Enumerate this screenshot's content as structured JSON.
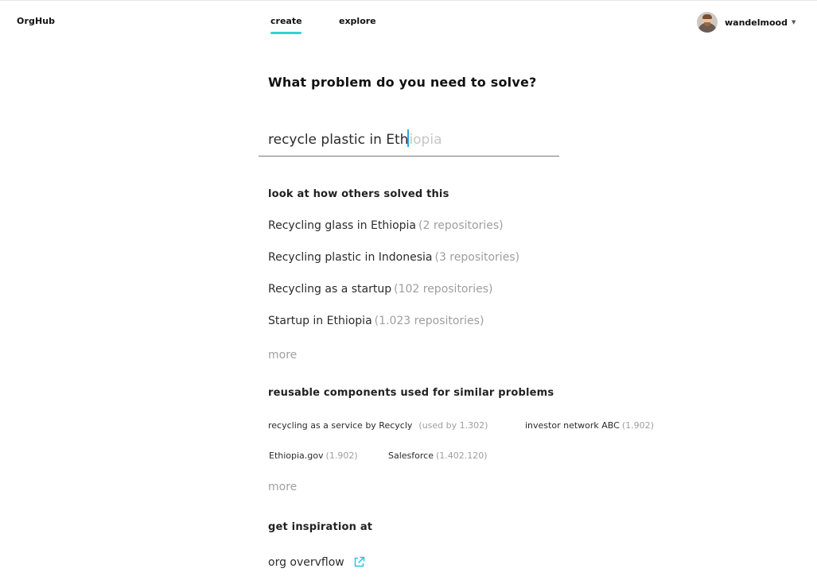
{
  "brand": {
    "name": "OrgHub"
  },
  "nav": {
    "tabs": [
      {
        "label": "create",
        "active": true
      },
      {
        "label": "explore",
        "active": false
      }
    ],
    "accent_color": "#2dd4d4"
  },
  "user": {
    "name": "wandelmood",
    "caret_icon": "chevron-down-icon"
  },
  "main": {
    "question": "What problem do you need to solve?",
    "search": {
      "typed": "recycle plastic in Eth",
      "suggestion": "iopia",
      "cursor_color": "#2aa7e8"
    },
    "solutions_section": {
      "title": "look at how others solved this",
      "items": [
        {
          "label": "Recycling glass in Ethiopia",
          "count": "(2 repositories)"
        },
        {
          "label": "Recycling plastic in Indonesia",
          "count": "(3 repositories)"
        },
        {
          "label": "Recycling as a startup",
          "count": "(102 repositories)"
        },
        {
          "label": "Startup in Ethiopia",
          "count": "(1.023 repositories)"
        }
      ],
      "more": "more"
    },
    "components_section": {
      "title": "reusable components used for similar problems",
      "items": [
        {
          "label": "recycling as a service by Recycly",
          "count": "(used  by 1.302)"
        },
        {
          "label": "investor network ABC",
          "count": "(1.902)"
        },
        {
          "label": "Ethiopia.gov",
          "count": "(1.902)"
        },
        {
          "label": "Salesforce",
          "count": "(1.402.120)"
        }
      ],
      "more": "more"
    },
    "inspiration_section": {
      "title": "get inspiration at",
      "link": {
        "label": "org overvflow",
        "icon": "external-link-icon",
        "icon_color": "#2dc4e0"
      }
    }
  }
}
